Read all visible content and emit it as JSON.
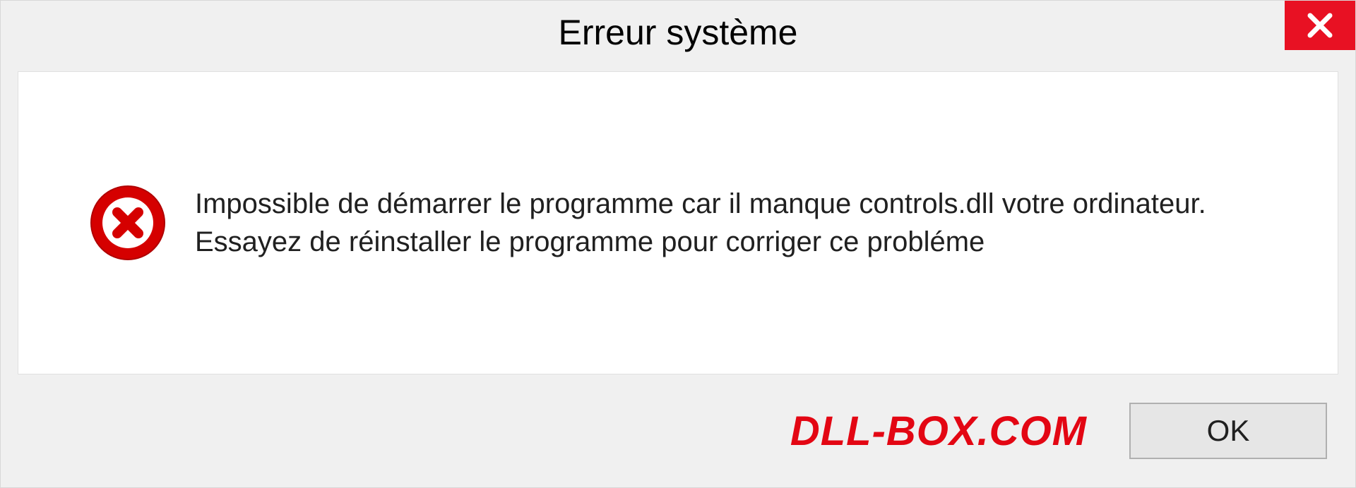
{
  "dialog": {
    "title": "Erreur système",
    "message": "Impossible de démarrer le programme car il manque controls.dll votre ordinateur. Essayez de réinstaller le programme pour corriger ce probléme",
    "ok_label": "OK"
  },
  "watermark": "DLL-BOX.COM",
  "colors": {
    "close_bg": "#e81123",
    "error_icon": "#d50000",
    "watermark": "#e30613"
  }
}
